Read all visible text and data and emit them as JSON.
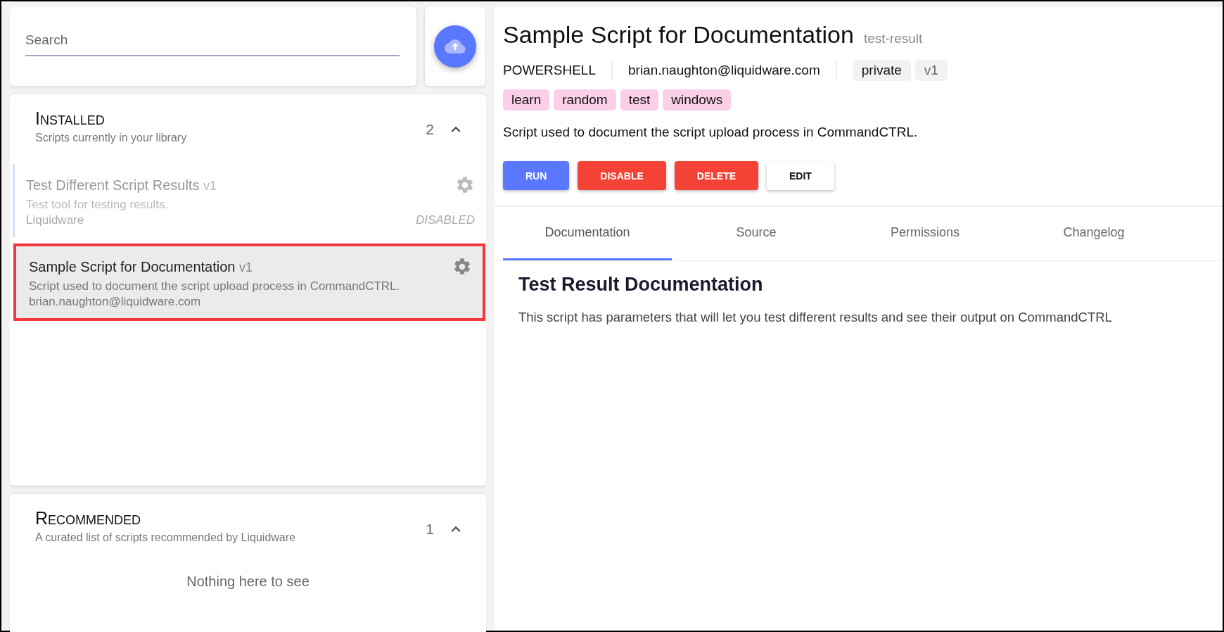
{
  "search": {
    "placeholder": "Search"
  },
  "sections": [
    {
      "title": "Installed",
      "subtitle": "Scripts currently in your library",
      "count": "2",
      "expanded": true,
      "scripts": [
        {
          "name": "Test Different Script Results",
          "version": "v1",
          "description": "Test tool for testing results.",
          "author": "Liquidware",
          "disabled": true,
          "status": "DISABLED",
          "selected": false
        },
        {
          "name": "Sample Script for Documentation",
          "version": "v1",
          "description": "Script used to document the script upload process in CommandCTRL.",
          "author": "brian.naughton@liquidware.com",
          "disabled": false,
          "selected": true
        }
      ]
    },
    {
      "title": "Recommended",
      "subtitle": "A curated list of scripts recommended by Liquidware",
      "count": "1",
      "expanded": true,
      "empty_text": "Nothing here to see"
    }
  ],
  "detail": {
    "title": "Sample Script for Documentation",
    "slug": "test-result",
    "language": "POWERSHELL",
    "author": "brian.naughton@liquidware.com",
    "visibility": "private",
    "version": "v1",
    "tags": [
      "learn",
      "random",
      "test",
      "windows"
    ],
    "description": "Script used to document the script upload process in CommandCTRL.",
    "buttons": [
      {
        "label": "RUN",
        "kind": "primary"
      },
      {
        "label": "DISABLE",
        "kind": "danger"
      },
      {
        "label": "DELETE",
        "kind": "danger"
      },
      {
        "label": "EDIT",
        "kind": "plain"
      }
    ],
    "tabs": [
      {
        "label": "Documentation",
        "selected": true
      },
      {
        "label": "Source",
        "selected": false
      },
      {
        "label": "Permissions",
        "selected": false
      },
      {
        "label": "Changelog",
        "selected": false
      }
    ],
    "doc_heading": "Test Result Documentation",
    "doc_text": "This script has parameters that will let you test different results and see their output on CommandCTRL"
  }
}
